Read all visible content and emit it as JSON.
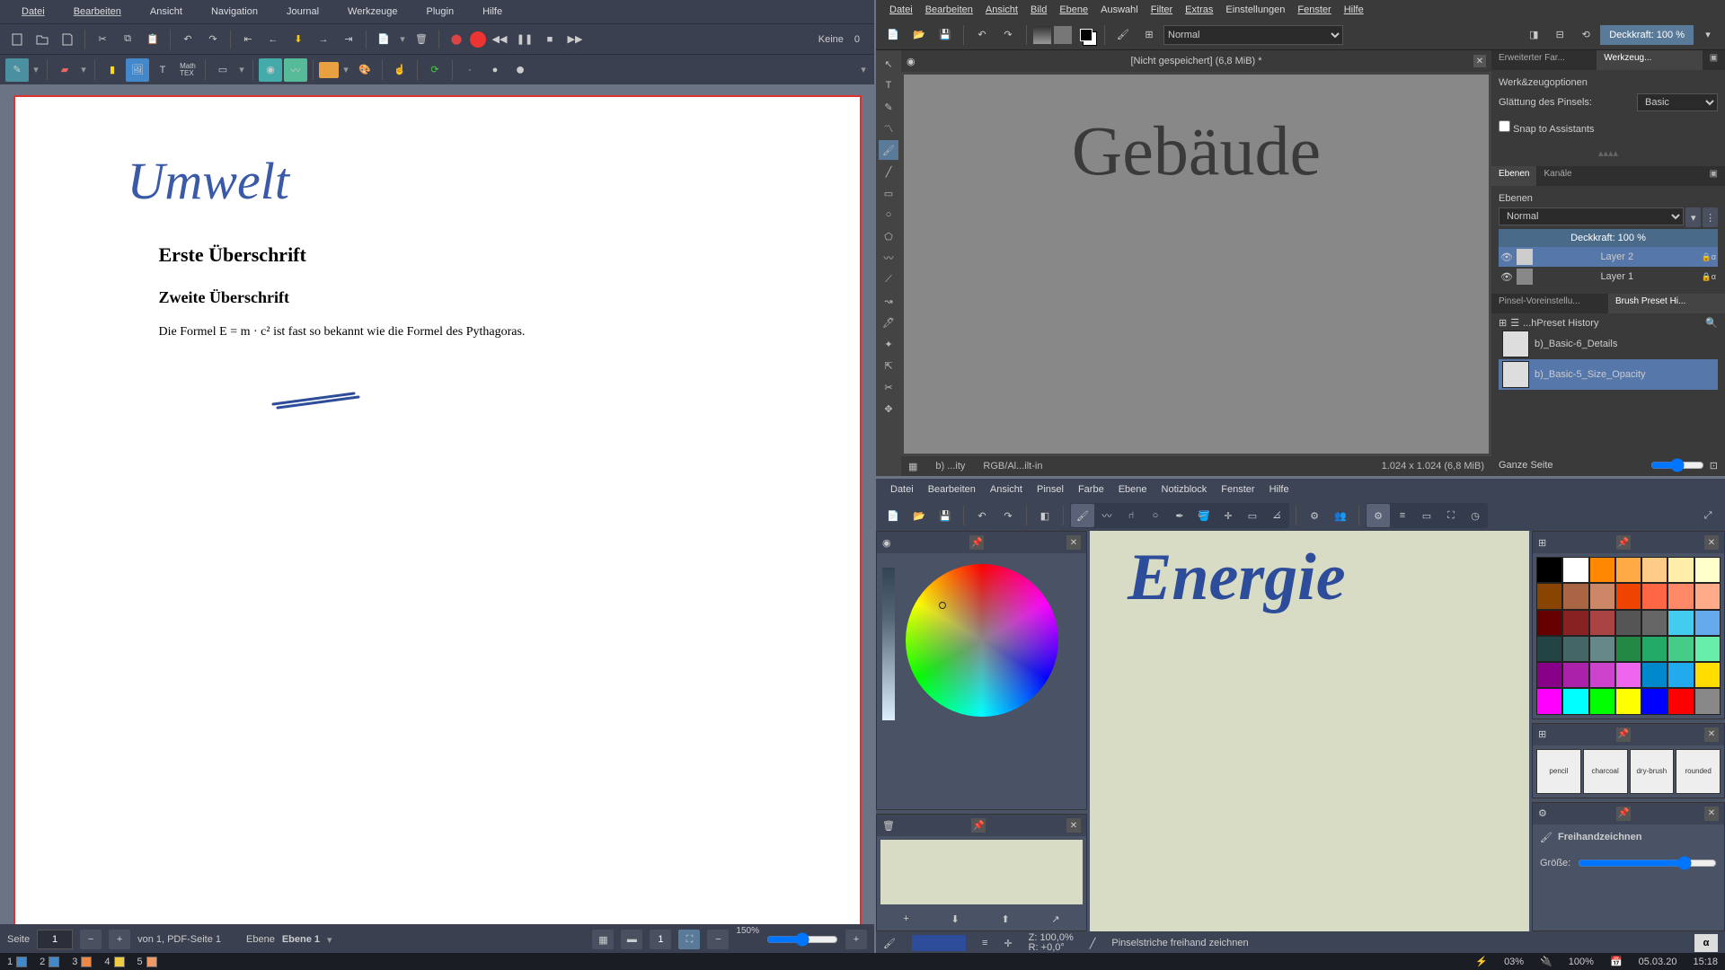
{
  "xournal": {
    "menu": [
      "Datei",
      "Bearbeiten",
      "Ansicht",
      "Navigation",
      "Journal",
      "Werkzeuge",
      "Plugin",
      "Hilfe"
    ],
    "layers_label": "Keine",
    "layer_count": "0",
    "page_title": "Umwelt",
    "h1": "Erste Überschrift",
    "h2": "Zweite Überschrift",
    "body": "Die Formel E = m · c² ist fast so bekannt wie die Formel des Pythagoras.",
    "status": {
      "page_lbl": "Seite",
      "page_val": "1",
      "of": "von 1, PDF-Seite 1",
      "layer_lbl": "Ebene",
      "layer_val": "Ebene 1",
      "page_btn": "1",
      "zoom": "150%"
    }
  },
  "krita": {
    "menu": [
      "Datei",
      "Bearbeiten",
      "Ansicht",
      "Bild",
      "Ebene",
      "Auswahl",
      "Filter",
      "Extras",
      "Einstellungen",
      "Fenster",
      "Hilfe"
    ],
    "blend": "Normal",
    "opacity_label": "Deckkraft: 100 %",
    "doc_title": "[Nicht gespeichert]  (6,8 MiB) *",
    "artwork": "Gebäude",
    "status": {
      "left": "b) ...ity",
      "mid": "RGB/Al...ilt-in",
      "dim": "1.024 x 1.024 (6,8 MiB)"
    },
    "dockers": {
      "tab1": "Erweiterter Far...",
      "tab2": "Werkzeug...",
      "tool_opts": "Werk&zeugoptionen",
      "smoothing_lbl": "Glättung des Pinsels:",
      "smoothing_val": "Basic",
      "snap": "Snap to Assistants",
      "layers_tab": "Ebenen",
      "channels_tab": "Kanäle",
      "layers_lbl": "Ebenen",
      "blend": "Normal",
      "opacity": "Deckkraft:  100 %",
      "layer2": "Layer 2",
      "layer1": "Layer 1",
      "preset_tab1": "Pinsel-Voreinstellu...",
      "preset_tab2": "Brush Preset Hi...",
      "preset_hist": "...hPreset History",
      "brush1": "b)_Basic-6_Details",
      "brush2": "b)_Basic-5_Size_Opacity",
      "fit": "Ganze Seite"
    }
  },
  "mypaint": {
    "menu": [
      "Datei",
      "Bearbeiten",
      "Ansicht",
      "Pinsel",
      "Farbe",
      "Ebene",
      "Notizblock",
      "Fenster",
      "Hilfe"
    ],
    "artwork": "Energie",
    "zoom_lbl": "Z: 100,0%",
    "rot_lbl": "R: +0,0°",
    "status_hint": "Pinselstriche freihand zeichnen",
    "tool_name": "Freihandzeichnen",
    "size_lbl": "Größe:",
    "brushes": [
      "pencil",
      "charcoal",
      "dry-brush",
      "rounded"
    ],
    "palette": [
      "#000",
      "#fff",
      "#f80",
      "#fa4",
      "#fc8",
      "#fea",
      "#ffc",
      "#840",
      "#a64",
      "#c86",
      "#e40",
      "#f64",
      "#f86",
      "#fa8",
      "#600",
      "#822",
      "#a44",
      "#555",
      "#666",
      "#4ce",
      "#6ae",
      "#244",
      "#466",
      "#688",
      "#284",
      "#2a6",
      "#4c8",
      "#6ea",
      "#808",
      "#a2a",
      "#c4c",
      "#e6e",
      "#08c",
      "#2ae",
      "#fd0",
      "#f0f",
      "#0ff",
      "#0f0",
      "#ff0",
      "#00f",
      "#f00",
      "#888"
    ]
  },
  "taskbar": {
    "cpu": "03%",
    "bat": "100%",
    "date": "05.03.20",
    "time": "15:18",
    "ws": [
      "1",
      "2",
      "3",
      "4",
      "5"
    ]
  }
}
